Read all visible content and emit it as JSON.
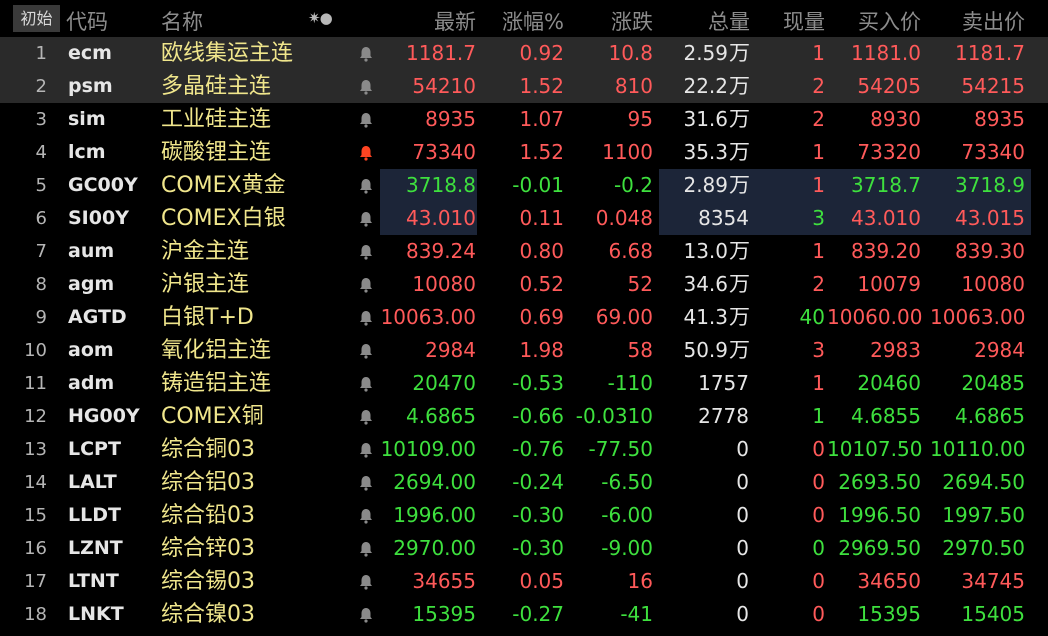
{
  "header": {
    "init_label": "初始",
    "code": "代码",
    "name": "名称",
    "settings_icon": "✷●",
    "last": "最新",
    "pct": "涨幅%",
    "chg": "涨跌",
    "vol": "总量",
    "cur": "现量",
    "bid": "买入价",
    "ask": "卖出价"
  },
  "colors": {
    "up": "#ff5a5a",
    "down": "#3ee03e",
    "name": "#f0e68c",
    "bell_active": "#ff4422",
    "bell": "#8a8a8a"
  },
  "rows": [
    {
      "num": "1",
      "code": "ecm",
      "name": "欧线集运主连",
      "last": "1181.7",
      "pct": "0.92",
      "chg": "10.8",
      "vol": "2.59",
      "vol_unit": "万",
      "cur": "1",
      "bid": "1181.0",
      "ask": "1181.7",
      "dir": "up"
    },
    {
      "num": "2",
      "code": "psm",
      "name": "多晶硅主连",
      "last": "54210",
      "pct": "1.52",
      "chg": "810",
      "vol": "22.2",
      "vol_unit": "万",
      "cur": "2",
      "bid": "54205",
      "ask": "54215",
      "dir": "up"
    },
    {
      "num": "3",
      "code": "sim",
      "name": "工业硅主连",
      "last": "8935",
      "pct": "1.07",
      "chg": "95",
      "vol": "31.6",
      "vol_unit": "万",
      "cur": "2",
      "bid": "8930",
      "ask": "8935",
      "dir": "up"
    },
    {
      "num": "4",
      "code": "lcm",
      "name": "碳酸锂主连",
      "last": "73340",
      "pct": "1.52",
      "chg": "1100",
      "vol": "35.3",
      "vol_unit": "万",
      "cur": "1",
      "bid": "73320",
      "ask": "73340",
      "dir": "up",
      "bell_active": true
    },
    {
      "num": "5",
      "code": "GC00Y",
      "name": "COMEX黄金",
      "last": "3718.8",
      "pct": "-0.01",
      "chg": "-0.2",
      "vol": "2.89",
      "vol_unit": "万",
      "cur": "1",
      "bid": "3718.7",
      "ask": "3718.9",
      "dir": "down",
      "cur_dir": "up"
    },
    {
      "num": "6",
      "code": "SI00Y",
      "name": "COMEX白银",
      "last": "43.010",
      "pct": "0.11",
      "chg": "0.048",
      "vol": "8354",
      "vol_unit": "",
      "cur": "3",
      "bid": "43.010",
      "ask": "43.015",
      "dir": "up",
      "cur_dir": "down"
    },
    {
      "num": "7",
      "code": "aum",
      "name": "沪金主连",
      "last": "839.24",
      "pct": "0.80",
      "chg": "6.68",
      "vol": "13.0",
      "vol_unit": "万",
      "cur": "1",
      "bid": "839.20",
      "ask": "839.30",
      "dir": "up"
    },
    {
      "num": "8",
      "code": "agm",
      "name": "沪银主连",
      "last": "10080",
      "pct": "0.52",
      "chg": "52",
      "vol": "34.6",
      "vol_unit": "万",
      "cur": "2",
      "bid": "10079",
      "ask": "10080",
      "dir": "up"
    },
    {
      "num": "9",
      "code": "AGTD",
      "name": "白银T+D",
      "last": "10063.00",
      "pct": "0.69",
      "chg": "69.00",
      "vol": "41.3",
      "vol_unit": "万",
      "cur": "40",
      "bid": "10060.00",
      "ask": "10063.00",
      "dir": "up",
      "cur_dir": "down"
    },
    {
      "num": "10",
      "code": "aom",
      "name": "氧化铝主连",
      "last": "2984",
      "pct": "1.98",
      "chg": "58",
      "vol": "50.9",
      "vol_unit": "万",
      "cur": "3",
      "bid": "2983",
      "ask": "2984",
      "dir": "up"
    },
    {
      "num": "11",
      "code": "adm",
      "name": "铸造铝主连",
      "last": "20470",
      "pct": "-0.53",
      "chg": "-110",
      "vol": "1757",
      "vol_unit": "",
      "cur": "1",
      "bid": "20460",
      "ask": "20485",
      "dir": "down",
      "cur_dir": "up"
    },
    {
      "num": "12",
      "code": "HG00Y",
      "name": "COMEX铜",
      "last": "4.6865",
      "pct": "-0.66",
      "chg": "-0.0310",
      "vol": "2778",
      "vol_unit": "",
      "cur": "1",
      "bid": "4.6855",
      "ask": "4.6865",
      "dir": "down"
    },
    {
      "num": "13",
      "code": "LCPT",
      "name": "综合铜03",
      "last": "10109.00",
      "pct": "-0.76",
      "chg": "-77.50",
      "vol": "0",
      "vol_unit": "",
      "cur": "0",
      "bid": "10107.50",
      "ask": "10110.00",
      "dir": "down",
      "cur_dir": "up"
    },
    {
      "num": "14",
      "code": "LALT",
      "name": "综合铝03",
      "last": "2694.00",
      "pct": "-0.24",
      "chg": "-6.50",
      "vol": "0",
      "vol_unit": "",
      "cur": "0",
      "bid": "2693.50",
      "ask": "2694.50",
      "dir": "down",
      "cur_dir": "up"
    },
    {
      "num": "15",
      "code": "LLDT",
      "name": "综合铅03",
      "last": "1996.00",
      "pct": "-0.30",
      "chg": "-6.00",
      "vol": "0",
      "vol_unit": "",
      "cur": "0",
      "bid": "1996.50",
      "ask": "1997.50",
      "dir": "down",
      "cur_dir": "up"
    },
    {
      "num": "16",
      "code": "LZNT",
      "name": "综合锌03",
      "last": "2970.00",
      "pct": "-0.30",
      "chg": "-9.00",
      "vol": "0",
      "vol_unit": "",
      "cur": "0",
      "bid": "2969.50",
      "ask": "2970.50",
      "dir": "down"
    },
    {
      "num": "17",
      "code": "LTNT",
      "name": "综合锡03",
      "last": "34655",
      "pct": "0.05",
      "chg": "16",
      "vol": "0",
      "vol_unit": "",
      "cur": "0",
      "bid": "34650",
      "ask": "34745",
      "dir": "up"
    },
    {
      "num": "18",
      "code": "LNKT",
      "name": "综合镍03",
      "last": "15395",
      "pct": "-0.27",
      "chg": "-41",
      "vol": "0",
      "vol_unit": "",
      "cur": "0",
      "bid": "15395",
      "ask": "15405",
      "dir": "down",
      "cur_dir": "up"
    }
  ]
}
